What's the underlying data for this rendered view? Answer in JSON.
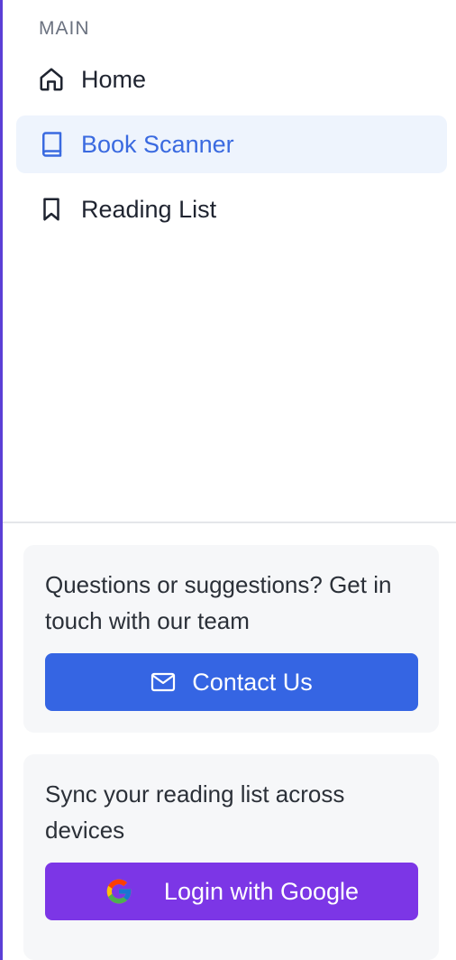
{
  "sidebar": {
    "section_label": "MAIN",
    "items": [
      {
        "label": "Home",
        "icon": "home-icon",
        "active": false
      },
      {
        "label": "Book Scanner",
        "icon": "book-icon",
        "active": true
      },
      {
        "label": "Reading List",
        "icon": "bookmark-icon",
        "active": false
      }
    ]
  },
  "contact_card": {
    "text": "Questions or suggestions? Get in touch with our team",
    "button_label": "Contact Us",
    "button_icon": "mail-icon"
  },
  "sync_card": {
    "text": "Sync your reading list across devices",
    "button_label": "Login with Google",
    "button_icon": "google-icon"
  },
  "colors": {
    "active_bg": "#eef4fd",
    "active_text": "#3a6ae0",
    "contact_button": "#3565e3",
    "google_button": "#7c36e6",
    "left_border": "#5b3fd6"
  }
}
